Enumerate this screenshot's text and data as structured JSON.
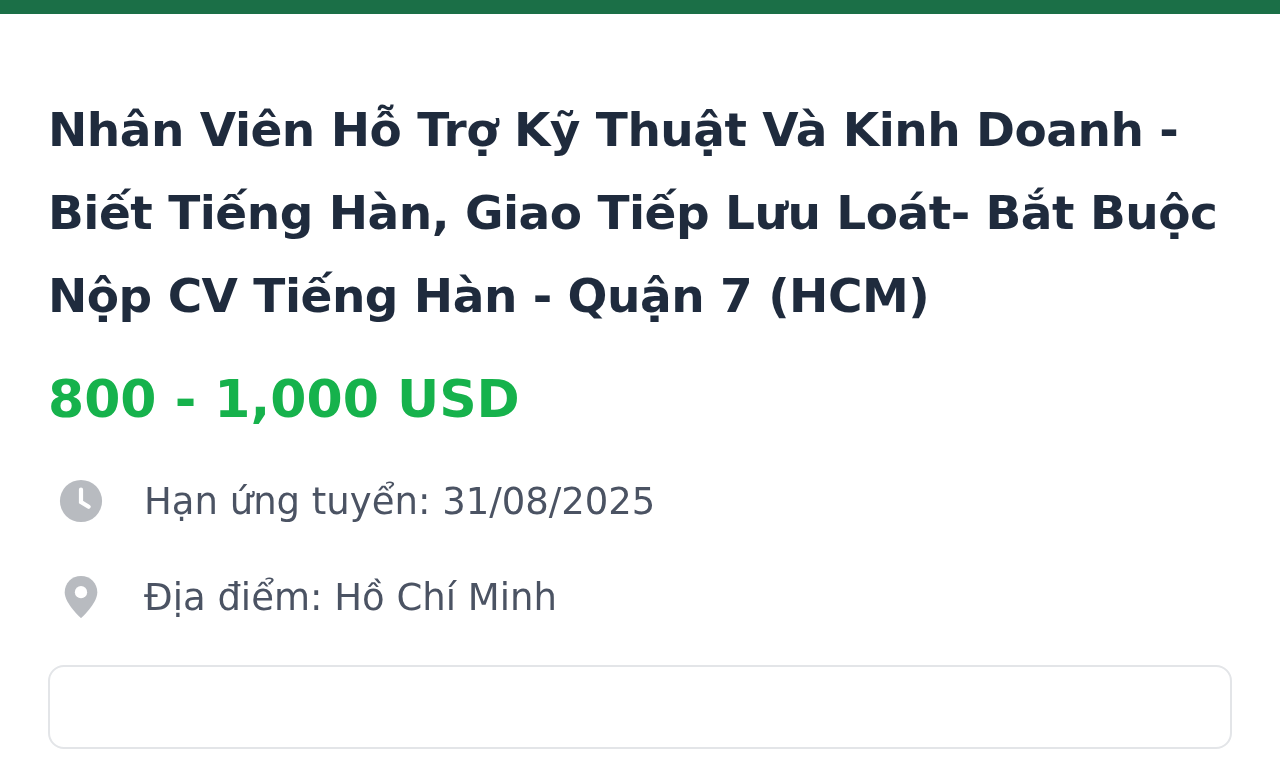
{
  "job": {
    "title": "Nhân Viên Hỗ Trợ Kỹ Thuật Và Kinh Doanh - Biết Tiếng Hàn, Giao Tiếp Lưu Loát- Bắt Buộc Nộp CV Tiếng Hàn - Quận 7 (HCM)",
    "salary": "800 - 1,000 USD",
    "details": [
      {
        "kind": "deadline",
        "text": "Hạn ứng tuyển: 31/08/2025"
      },
      {
        "kind": "location",
        "text": "Địa điểm: Hồ Chí Minh"
      }
    ]
  }
}
